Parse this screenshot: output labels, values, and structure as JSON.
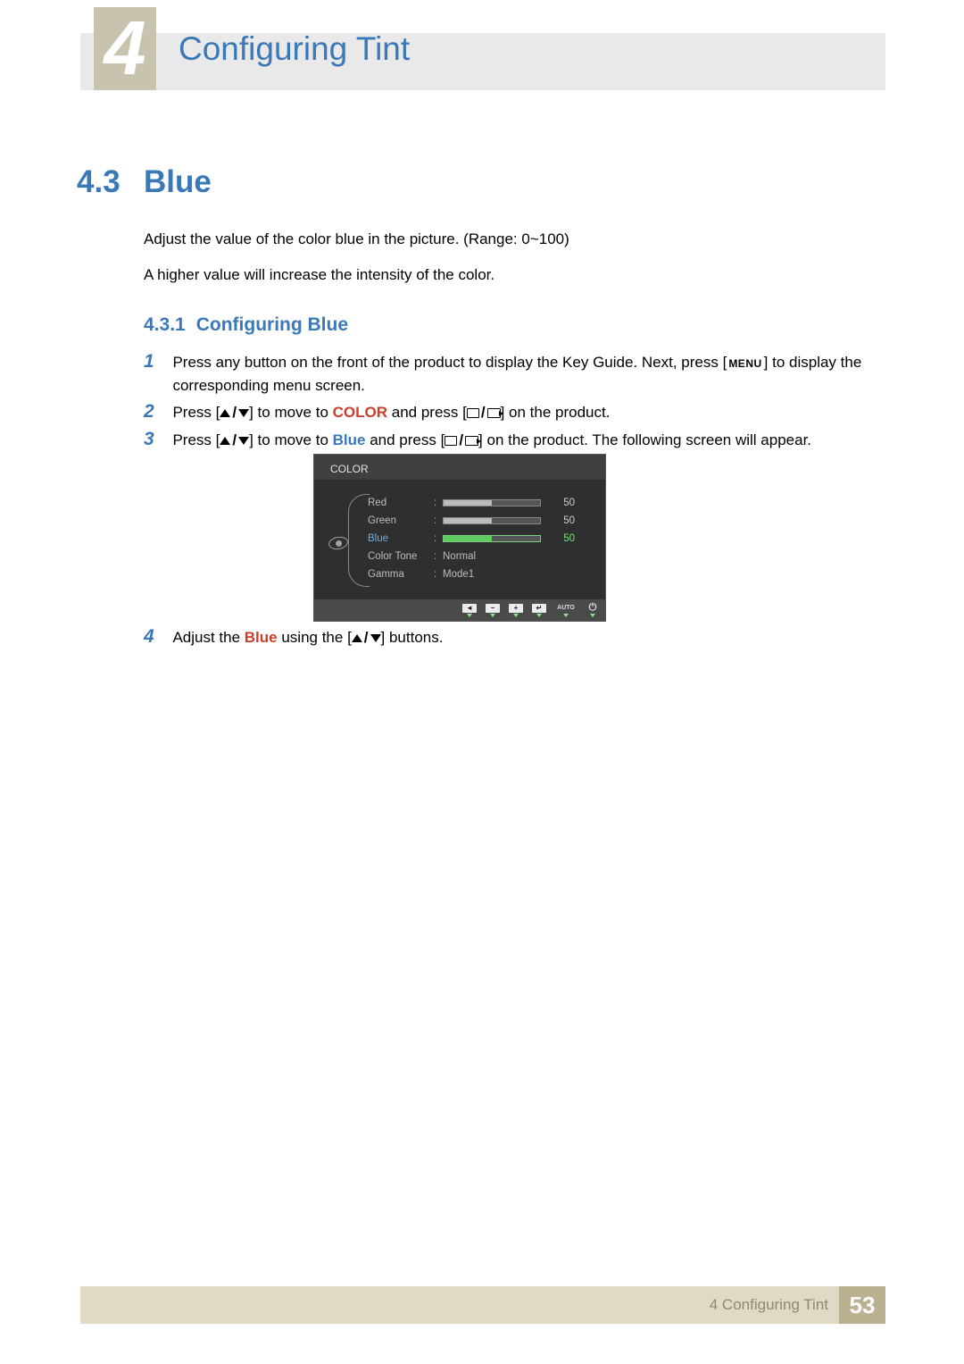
{
  "header": {
    "chapter_number": "4",
    "chapter_title": "Configuring Tint"
  },
  "section": {
    "number": "4.3",
    "title": "Blue",
    "intro1": "Adjust the value of the color blue in the picture. (Range: 0~100)",
    "intro2": "A higher value will increase the intensity of the color."
  },
  "subsection": {
    "number": "4.3.1",
    "title": "Configuring Blue"
  },
  "steps": {
    "s1": {
      "num": "1",
      "pre": "Press any button on the front of the product to display the Key Guide. Next, press [",
      "menu": "MENU",
      "post": "] to display the corresponding menu screen."
    },
    "s2": {
      "num": "2",
      "a": "Press [",
      "b": "] to move to ",
      "color": "COLOR",
      "c": " and press [",
      "d": "] on the product."
    },
    "s3": {
      "num": "3",
      "a": "Press [",
      "b": "] to move to ",
      "blue": "Blue",
      "c": " and press [",
      "d": "] on the product. The following screen will appear."
    },
    "s4": {
      "num": "4",
      "a": "Adjust the ",
      "blue": "Blue",
      "b": " using the [",
      "c": "] buttons."
    }
  },
  "osd": {
    "title": "COLOR",
    "rows": {
      "red": {
        "label": "Red",
        "value": "50"
      },
      "green": {
        "label": "Green",
        "value": "50"
      },
      "blue": {
        "label": "Blue",
        "value": "50"
      },
      "tone": {
        "label": "Color Tone",
        "value": "Normal"
      },
      "gamma": {
        "label": "Gamma",
        "value": "Mode1"
      }
    },
    "bar": {
      "auto": "AUTO"
    }
  },
  "footer": {
    "label": "4 Configuring Tint",
    "page": "53"
  }
}
